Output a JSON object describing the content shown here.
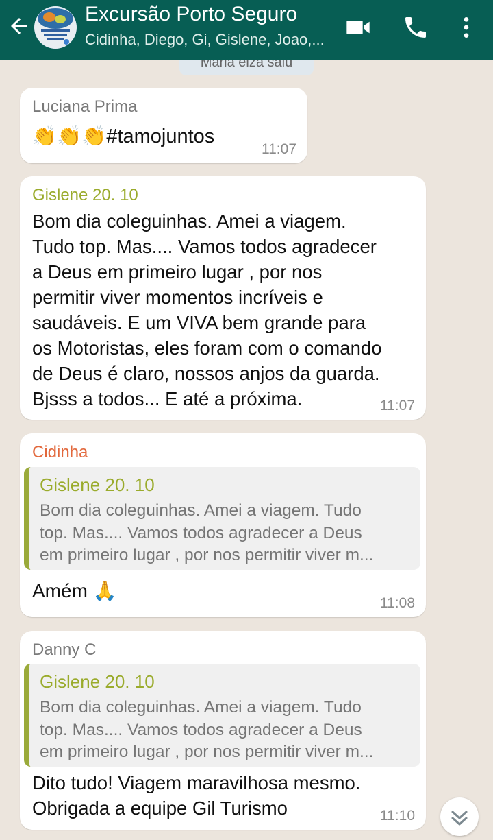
{
  "header": {
    "title": "Excursão Porto Seguro",
    "subtitle": "Cidinha, Diego, Gi, Gislene, Joao,...",
    "icons": [
      "back-arrow-icon",
      "group-avatar",
      "video-call-icon",
      "voice-call-icon",
      "more-options-icon"
    ]
  },
  "system_message": "Maria eiza saiu",
  "messages": [
    {
      "sender": "Luciana Prima",
      "sender_color": "#7a7a7a",
      "text": "👏👏👏#tamojuntos",
      "time": "11:07"
    },
    {
      "sender": "Gislene 20. 10",
      "sender_color": "#9aab2c",
      "lines": [
        "Bom dia coleguinhas. Amei a viagem.",
        "Tudo top. Mas.... Vamos todos  agradecer",
        "a Deus em primeiro lugar , por nos",
        "permitir viver momentos incríveis e",
        "saudáveis.  E um VIVA bem grande para",
        "os Motoristas, eles foram com o comando",
        "de Deus é claro, nossos anjos da guarda.",
        "Bjsss a todos... E até a próxima."
      ],
      "time": "11:07"
    },
    {
      "sender": "Cidinha",
      "sender_color": "#e2683c",
      "quote": {
        "sender": "Gislene 20. 10",
        "lines": [
          "Bom dia coleguinhas. Amei a viagem.  Tudo",
          "top. Mas.... Vamos todos  agradecer a Deus",
          "em primeiro lugar , por nos permitir viver m..."
        ]
      },
      "text": "Amém 🙏",
      "time": "11:08"
    },
    {
      "sender": "Danny C",
      "sender_color": "#7a7a7a",
      "quote": {
        "sender": "Gislene 20. 10",
        "lines": [
          "Bom dia coleguinhas. Amei a viagem.  Tudo",
          "top. Mas.... Vamos todos  agradecer a Deus",
          "em primeiro lugar , por nos permitir viver m..."
        ]
      },
      "lines": [
        "Dito tudo! Viagem maravilhosa mesmo.",
        "Obrigada a equipe Gil Turismo"
      ],
      "time": "11:10"
    }
  ],
  "colors": {
    "header_bg": "#075e54",
    "chat_bg": "#ece5dd",
    "bubble_bg": "#ffffff",
    "quote_accent": "#9aab2c"
  },
  "scroll_icon": "double-chevron-down-icon"
}
